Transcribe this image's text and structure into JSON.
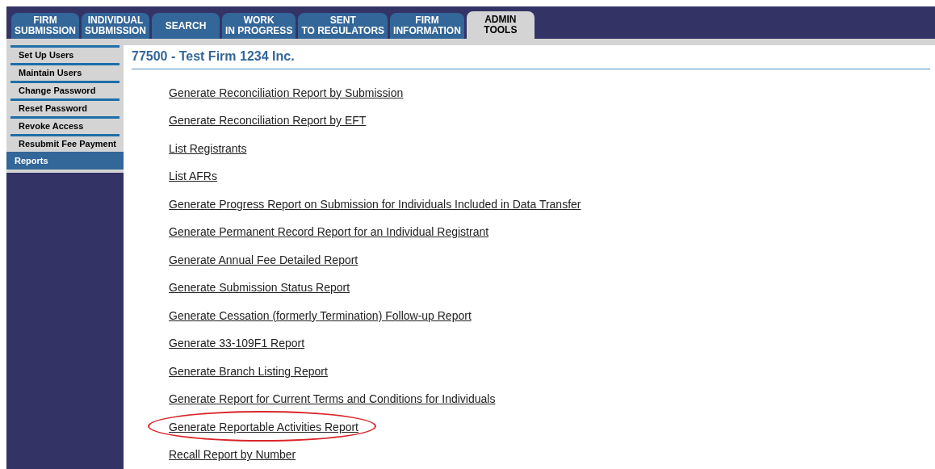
{
  "tabs": [
    {
      "label": "FIRM SUBMISSION",
      "selected": false
    },
    {
      "label": "INDIVIDUAL SUBMISSION",
      "selected": false
    },
    {
      "label": "SEARCH",
      "selected": false
    },
    {
      "label": "WORK IN PROGRESS",
      "selected": false
    },
    {
      "label": "SENT TO REGULATORS",
      "selected": false
    },
    {
      "label": "FIRM INFORMATION",
      "selected": false
    },
    {
      "label": "ADMIN TOOLS",
      "selected": true
    }
  ],
  "sidebar": {
    "items": [
      {
        "label": "Set Up Users",
        "selected": false
      },
      {
        "label": "Maintain Users",
        "selected": false
      },
      {
        "label": "Change Password",
        "selected": false
      },
      {
        "label": "Reset Password",
        "selected": false
      },
      {
        "label": "Revoke Access",
        "selected": false
      },
      {
        "label": "Resubmit Fee Payment",
        "selected": false
      },
      {
        "label": "Reports",
        "selected": true
      }
    ]
  },
  "heading": "77500 - Test Firm 1234 Inc.",
  "links": [
    {
      "label": "Generate Reconciliation Report by Submission",
      "highlighted": false
    },
    {
      "label": "Generate Reconciliation Report by EFT",
      "highlighted": false
    },
    {
      "label": "List Registrants",
      "highlighted": false
    },
    {
      "label": "List AFRs",
      "highlighted": false
    },
    {
      "label": "Generate Progress Report on Submission for Individuals Included in Data Transfer",
      "highlighted": false
    },
    {
      "label": "Generate Permanent Record Report for an Individual Registrant",
      "highlighted": false
    },
    {
      "label": "Generate Annual Fee Detailed Report",
      "highlighted": false
    },
    {
      "label": "Generate Submission Status Report",
      "highlighted": false
    },
    {
      "label": "Generate Cessation (formerly Termination) Follow-up Report",
      "highlighted": false
    },
    {
      "label": "Generate 33-109F1 Report",
      "highlighted": false
    },
    {
      "label": "Generate Branch Listing Report",
      "highlighted": false
    },
    {
      "label": "Generate Report for Current Terms and Conditions for Individuals",
      "highlighted": false
    },
    {
      "label": "Generate Reportable Activities Report",
      "highlighted": true
    },
    {
      "label": "Recall Report by Number",
      "highlighted": false
    }
  ]
}
